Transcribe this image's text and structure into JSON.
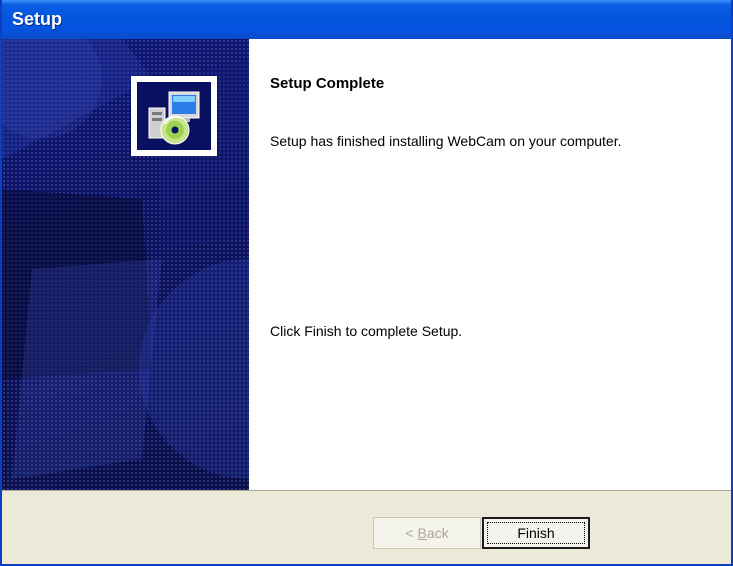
{
  "window": {
    "title": "Setup"
  },
  "side_panel": {
    "icon": "setup-computer-cd-icon"
  },
  "content": {
    "heading": "Setup Complete",
    "message": "Setup has finished installing WebCam on your computer.",
    "instruction": "Click Finish to complete Setup."
  },
  "buttons": {
    "back_label": "< Back",
    "back_prefix": "< ",
    "back_mnemonic": "B",
    "back_rest": "ack",
    "back_enabled": false,
    "finish_label": "Finish"
  }
}
